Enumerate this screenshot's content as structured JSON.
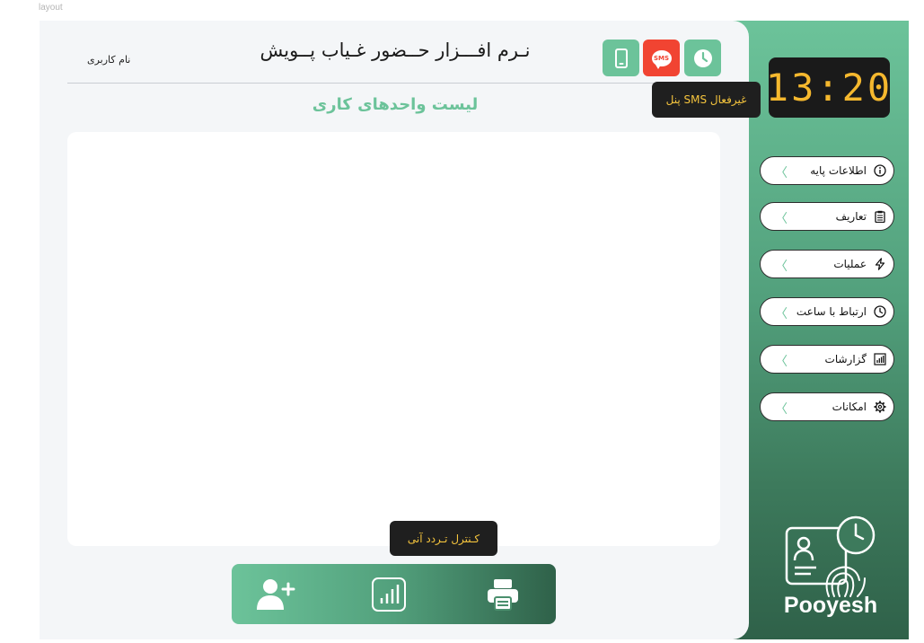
{
  "frame_label": "layout",
  "header": {
    "username": "نام کاربری",
    "app_title": "نـرم افـــزار حــضور غـیاب پــویش"
  },
  "tooltips": {
    "sms_panel": "پنل SMS غیرفعال",
    "control": "کـنترل تـردد آنی"
  },
  "sms_icon_text": "SMS",
  "section_title": "لیست واحدهای کاری",
  "clock": {
    "time": "13:20"
  },
  "menu": [
    {
      "label": "اطلاعات پایه",
      "icon": "info-icon"
    },
    {
      "label": "تعاریف",
      "icon": "clipboard-icon"
    },
    {
      "label": "عملیات",
      "icon": "lightning-icon"
    },
    {
      "label": "ارتباط با ساعت",
      "icon": "clock-icon"
    },
    {
      "label": "گزارشات",
      "icon": "report-icon"
    },
    {
      "label": "امکانات",
      "icon": "gear-icon"
    }
  ],
  "brand": {
    "name": "Pooyesh"
  },
  "colors": {
    "accent_green": "#6cc39a",
    "dark_green": "#2f6149",
    "alert_red": "#f14432",
    "clock_digits": "#f5b82e",
    "tooltip_text": "#f6c53d"
  }
}
